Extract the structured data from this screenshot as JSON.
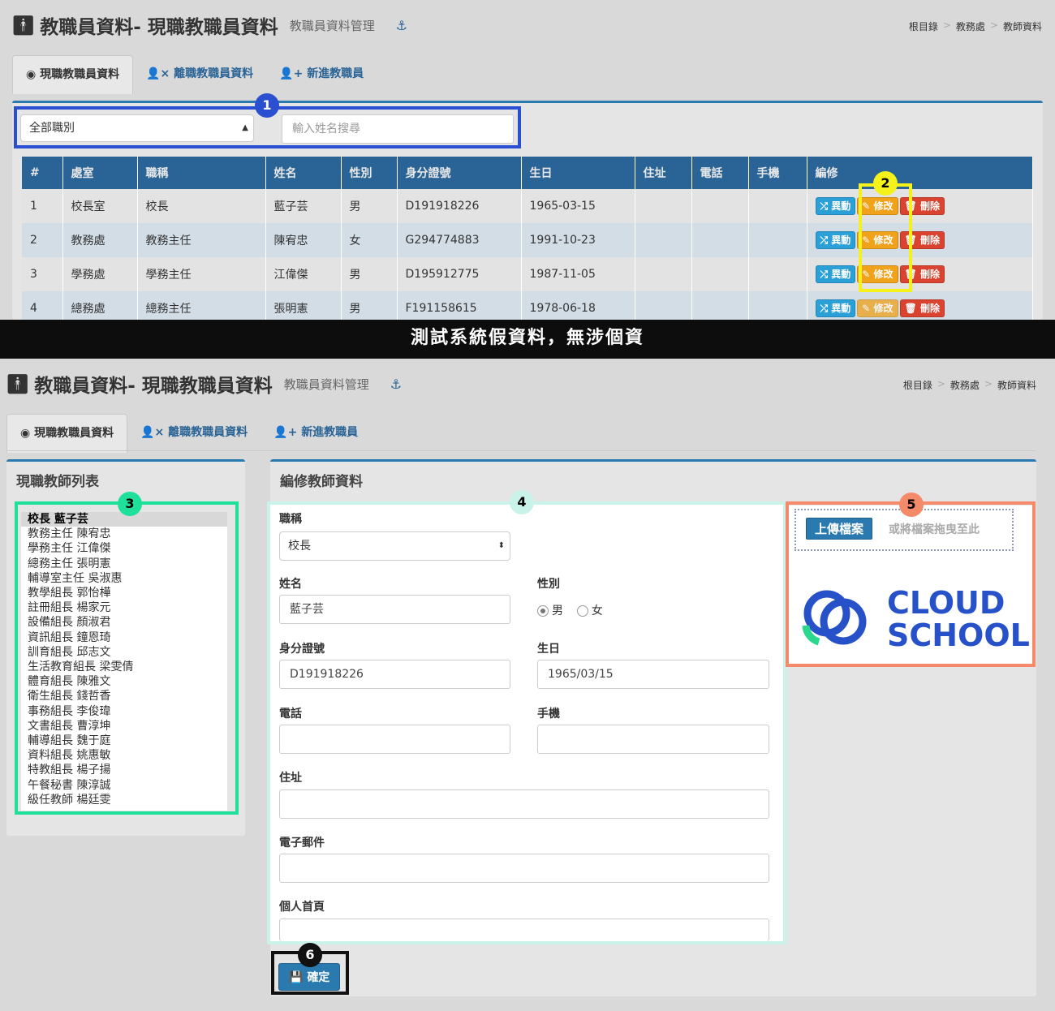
{
  "page": {
    "title": "教職員資料- 現職教職員資料",
    "subtitle": "教職員資料管理",
    "breadcrumb": [
      "根目錄",
      "教務處",
      "教師資料"
    ]
  },
  "tabs": [
    "現職教職員資料",
    "離職教職員資料",
    "新進教職員"
  ],
  "filter": {
    "role_select": "全部職別",
    "search_placeholder": "輸入姓名搜尋"
  },
  "table": {
    "headers": [
      "#",
      "處室",
      "職稱",
      "姓名",
      "性別",
      "身分證號",
      "生日",
      "住址",
      "電話",
      "手機",
      "編修"
    ],
    "rows": [
      {
        "no": "1",
        "dept": "校長室",
        "title": "校長",
        "name": "藍子芸",
        "gender": "男",
        "id": "D191918226",
        "birthday": "1965-03-15"
      },
      {
        "no": "2",
        "dept": "教務處",
        "title": "教務主任",
        "name": "陳宥忠",
        "gender": "女",
        "id": "G294774883",
        "birthday": "1991-10-23"
      },
      {
        "no": "3",
        "dept": "學務處",
        "title": "學務主任",
        "name": "江偉傑",
        "gender": "男",
        "id": "D195912775",
        "birthday": "1987-11-05"
      },
      {
        "no": "4",
        "dept": "總務處",
        "title": "總務主任",
        "name": "張明憲",
        "gender": "男",
        "id": "F191158615",
        "birthday": "1978-06-18"
      }
    ],
    "actions": {
      "transfer": "異動",
      "edit": "修改",
      "delete": "刪除"
    }
  },
  "banner": "測試系統假資料，無涉個資",
  "teacher_list": {
    "heading": "現職教師列表",
    "items": [
      "校長 藍子芸",
      "教務主任 陳宥忠",
      "學務主任 江偉傑",
      "總務主任 張明憲",
      "輔導室主任 吳淑惠",
      "教學組長 郭怡樺",
      "註冊組長 楊家元",
      "設備組長 顏淑君",
      "資訊組長 鐘恩琦",
      "訓育組長 邱志文",
      "生活教育組長 梁雯倩",
      "體育組長 陳雅文",
      "衛生組長 錢哲香",
      "事務組長 李俊瑋",
      "文書組長 曹淳坤",
      "輔導組長 魏于庭",
      "資料組長 姚惠敏",
      "特教組長 楊子揚",
      "午餐秘書 陳淳誠",
      "級任教師 楊廷雯"
    ]
  },
  "edit_form": {
    "heading": "編修教師資料",
    "title_label": "職稱",
    "title_value": "校長",
    "name_label": "姓名",
    "name_value": "藍子芸",
    "gender_label": "性別",
    "gender_male": "男",
    "gender_female": "女",
    "id_label": "身分證號",
    "id_value": "D191918226",
    "birthday_label": "生日",
    "birthday_value": "1965/03/15",
    "phone_label": "電話",
    "mobile_label": "手機",
    "address_label": "住址",
    "email_label": "電子郵件",
    "homepage_label": "個人首頁",
    "confirm": "確定"
  },
  "upload": {
    "button": "上傳檔案",
    "hint": "或將檔案拖曳至此",
    "logo_line1": "CLOUD",
    "logo_line2": "SCHOOL"
  },
  "annotations": [
    "1",
    "2",
    "3",
    "4",
    "5",
    "6"
  ],
  "colors": {
    "blue_box": "#2a4fd0",
    "yellow_box": "#f5f11a",
    "green_box": "#1fe09a",
    "mint_box": "#c9f2e8",
    "coral_box": "#f58a6a",
    "black_box": "#111111"
  }
}
